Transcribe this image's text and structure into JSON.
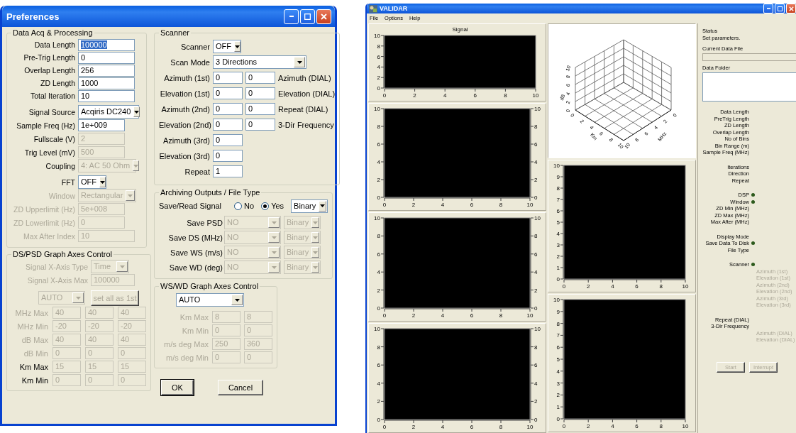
{
  "preferences": {
    "title": "Preferences",
    "acquisition": {
      "title": "Data Acq & Processing",
      "rows": [
        {
          "label": "Data Length",
          "kind": "text",
          "value": "100000",
          "disabled": false,
          "label_disabled": false,
          "highlighted": true
        },
        {
          "label": "Pre-Trig Length",
          "kind": "text",
          "value": "0",
          "disabled": false,
          "label_disabled": false,
          "highlighted": false
        },
        {
          "label": "Overlap Length",
          "kind": "text",
          "value": "256",
          "disabled": false,
          "label_disabled": false,
          "highlighted": false
        },
        {
          "label": "ZD Length",
          "kind": "text",
          "value": "1000",
          "disabled": false,
          "label_disabled": false,
          "highlighted": false
        },
        {
          "label": "Total Iteration",
          "kind": "text",
          "value": "10",
          "disabled": false,
          "label_disabled": false,
          "highlighted": false
        },
        {
          "label": "Signal Source",
          "kind": "combo",
          "value": "Acqiris DC240",
          "disabled": false,
          "label_disabled": false
        },
        {
          "label": "Sample Freq (Hz)",
          "kind": "text",
          "value": "1e+009",
          "disabled": false,
          "label_disabled": false,
          "highlighted": false
        },
        {
          "label": "Fullscale (V)",
          "kind": "text",
          "value": "2",
          "disabled": true,
          "label_disabled": false,
          "highlighted": false
        },
        {
          "label": "Trig Level (mV)",
          "kind": "text",
          "value": "500",
          "disabled": true,
          "label_disabled": false,
          "highlighted": false
        },
        {
          "label": "Coupling",
          "kind": "combo",
          "value": "4: AC 50 Ohm",
          "disabled": true,
          "label_disabled": false
        },
        {
          "label": "FFT",
          "kind": "combo",
          "value": "OFF",
          "disabled": false,
          "label_disabled": false
        },
        {
          "label": "Window",
          "kind": "combo",
          "value": "Rectangular",
          "disabled": true,
          "label_disabled": true
        },
        {
          "label": "ZD Upperlimit (Hz)",
          "kind": "text",
          "value": "5e+008",
          "disabled": true,
          "label_disabled": true,
          "highlighted": false
        },
        {
          "label": "ZD Lowerlimit (Hz)",
          "kind": "text",
          "value": "0",
          "disabled": true,
          "label_disabled": true,
          "highlighted": false
        },
        {
          "label": "Max After Index",
          "kind": "text",
          "value": "10",
          "disabled": true,
          "label_disabled": true,
          "highlighted": false
        }
      ]
    },
    "graph_axes": {
      "title": "DS/PSD Graph Axes Control",
      "rows": [
        {
          "label": "Signal X-Axis Type",
          "kind": "combo",
          "value": "Time",
          "disabled": true,
          "label_disabled": true
        },
        {
          "label": "Signal X-Axis Max",
          "kind": "text",
          "value": "100000",
          "disabled": true,
          "label_disabled": true
        }
      ],
      "mode": {
        "value": "AUTO",
        "disabled": true
      },
      "copy_button": {
        "label": "set all as 1st",
        "disabled": true
      },
      "grid": [
        {
          "label": "MHz Max",
          "values": [
            "40",
            "40",
            "40"
          ],
          "disabled": true,
          "label_disabled": true
        },
        {
          "label": "MHz Min",
          "values": [
            "-20",
            "-20",
            "-20"
          ],
          "disabled": true,
          "label_disabled": true
        },
        {
          "label": "dB Max",
          "values": [
            "40",
            "40",
            "40"
          ],
          "disabled": true,
          "label_disabled": true
        },
        {
          "label": "dB Min",
          "values": [
            "0",
            "0",
            "0"
          ],
          "disabled": true,
          "label_disabled": true
        },
        {
          "label": "Km Max",
          "values": [
            "15",
            "15",
            "15"
          ],
          "disabled": true,
          "label_disabled": false
        },
        {
          "label": "Km Min",
          "values": [
            "0",
            "0",
            "0"
          ],
          "disabled": true,
          "label_disabled": false
        }
      ]
    },
    "scanner": {
      "title": "Scanner",
      "rows": [
        {
          "label": "Scanner",
          "kind": "combo",
          "value": "OFF"
        },
        {
          "label": "Scan Mode",
          "kind": "combo",
          "value": "3 Directions"
        },
        {
          "label": "Azimuth (1st)",
          "kind": "pair",
          "values": [
            "0",
            "0"
          ],
          "note": "Azimuth (DIAL)"
        },
        {
          "label": "Elevation (1st)",
          "kind": "pair",
          "values": [
            "0",
            "0"
          ],
          "note": "Elevation (DIAL)"
        },
        {
          "label": "Azimuth (2nd)",
          "kind": "pair",
          "values": [
            "0",
            "0"
          ],
          "note": "Repeat (DIAL)"
        },
        {
          "label": "Elevation (2nd)",
          "kind": "pair",
          "values": [
            "0",
            "0"
          ],
          "note": "3-Dir Frequency"
        },
        {
          "label": "Azimuth (3rd)",
          "kind": "text",
          "value": "0"
        },
        {
          "label": "Elevation (3rd)",
          "kind": "text",
          "value": "0"
        },
        {
          "label": "Repeat",
          "kind": "text",
          "value": "1"
        }
      ]
    },
    "archiving": {
      "title": "Archiving Outputs / File Type",
      "signal": {
        "label": "Save/Read Signal",
        "options": [
          {
            "label": "No",
            "selected": false
          },
          {
            "label": "Yes",
            "selected": true
          }
        ],
        "format": "Binary"
      },
      "rows": [
        {
          "label": "Save PSD",
          "value": "NO",
          "format": "Binary",
          "disabled": true
        },
        {
          "label": "Save DS (MHz)",
          "value": "NO",
          "format": "Binary",
          "disabled": true
        },
        {
          "label": "Save WS (m/s)",
          "value": "NO",
          "format": "Binary",
          "disabled": true
        },
        {
          "label": "Save WD (deg)",
          "value": "NO",
          "format": "Binary",
          "disabled": true
        }
      ]
    },
    "ws_wd_axes": {
      "title": "WS/WD Graph Axes Control",
      "mode": "AUTO",
      "rows": [
        {
          "label": "Km Max",
          "values": [
            "8",
            "8"
          ],
          "disabled": true
        },
        {
          "label": "Km Min",
          "values": [
            "0",
            "0"
          ],
          "disabled": true
        },
        {
          "label": "m/s deg Max",
          "values": [
            "250",
            "360"
          ],
          "disabled": true
        },
        {
          "label": "m/s deg Min",
          "values": [
            "0",
            "0"
          ],
          "disabled": true
        }
      ]
    },
    "buttons": [
      {
        "label": "OK",
        "default": true
      },
      {
        "label": "Cancel",
        "default": false
      }
    ]
  },
  "validar": {
    "title": "VALIDAR",
    "menu": [
      "File",
      "Options",
      "Help"
    ],
    "plots": [
      {
        "chart_data": {
          "type": "line",
          "title": "Signal",
          "xlim": [
            0,
            10
          ],
          "ylim": [
            0,
            10
          ],
          "xticks": [
            0,
            2,
            4,
            6,
            8,
            10
          ],
          "yticks": [
            0,
            2,
            4,
            6,
            8,
            10
          ]
        }
      },
      {
        "right_yticks": [
          "10",
          "8",
          "6",
          "4",
          "2",
          "0"
        ],
        "chart_data": {
          "type": "line",
          "xlim": [
            0,
            10
          ],
          "ylim": [
            0,
            10
          ],
          "xticks": [
            0,
            2,
            4,
            6,
            8,
            10
          ],
          "yticks": [
            0,
            2,
            4,
            6,
            8,
            10
          ]
        }
      },
      {
        "right_yticks": [
          "10",
          "8",
          "6",
          "4",
          "2",
          "0"
        ],
        "chart_data": {
          "type": "line",
          "xlim": [
            0,
            10
          ],
          "ylim": [
            0,
            10
          ],
          "xticks": [
            0,
            2,
            4,
            6,
            8,
            10
          ],
          "yticks": [
            0,
            2,
            4,
            6,
            8,
            10
          ]
        }
      },
      {
        "right_yticks": [
          "10",
          "8",
          "6",
          "4",
          "2",
          "0"
        ],
        "chart_data": {
          "type": "line",
          "xlim": [
            0,
            10
          ],
          "ylim": [
            0,
            10
          ],
          "xticks": [
            0,
            2,
            4,
            6,
            8,
            10
          ],
          "yticks": [
            0,
            2,
            4,
            6,
            8,
            10
          ]
        }
      },
      {
        "chart_data": {
          "type": "line",
          "xlim": [
            0,
            10
          ],
          "ylim": [
            0,
            10
          ],
          "xticks": [
            0,
            2,
            4,
            6,
            8,
            10
          ],
          "yticks": [
            0,
            1,
            2,
            3,
            4,
            5,
            6,
            7,
            8,
            9,
            10
          ]
        }
      },
      {
        "chart_data": {
          "type": "line",
          "xlim": [
            0,
            10
          ],
          "ylim": [
            0,
            10
          ],
          "xticks": [
            0,
            2,
            4,
            6,
            8,
            10
          ],
          "yticks": [
            0,
            1,
            2,
            3,
            4,
            5,
            6,
            7,
            8,
            9,
            10
          ]
        }
      }
    ],
    "surface_plot": {
      "z_label": "dB",
      "x_label": "Km",
      "y_label": "MHz",
      "z_ticks": [
        "0",
        "2",
        "4",
        "6",
        "8",
        "10"
      ],
      "x_ticks": [
        "0",
        "2",
        "4",
        "6",
        "8",
        "10"
      ],
      "y_ticks": [
        "0",
        "2",
        "4",
        "6",
        "8",
        "10"
      ]
    },
    "status": {
      "title": "Status",
      "message": "Set parameters.",
      "current_file": {
        "label": "Current Data File",
        "disabled": true
      },
      "data_folder": {
        "label": "Data Folder"
      },
      "sections": [
        {
          "items": [
            {
              "label": "Data Length",
              "kind": "label"
            },
            {
              "label": "PreTrig Length",
              "kind": "label"
            },
            {
              "label": "ZD Length",
              "kind": "label"
            },
            {
              "label": "Overlap Length",
              "kind": "label"
            },
            {
              "label": "No of Bins",
              "kind": "label"
            },
            {
              "label": "Bin Range (m)",
              "kind": "label"
            },
            {
              "label": "Sample Freq (MHz)",
              "kind": "label"
            }
          ]
        },
        {
          "items": [
            {
              "label": "Iterations",
              "kind": "label"
            },
            {
              "label": "Direction",
              "kind": "label"
            },
            {
              "label": "Repeat",
              "kind": "label"
            }
          ]
        },
        {
          "items": [
            {
              "label": "DSP",
              "kind": "led",
              "on": false
            },
            {
              "label": "Window",
              "kind": "led",
              "on": false
            },
            {
              "label": "ZD Min (MHz)",
              "kind": "label"
            },
            {
              "label": "ZD Max (MHz)",
              "kind": "label"
            },
            {
              "label": "Max After (MHz)",
              "kind": "label"
            }
          ]
        },
        {
          "items": [
            {
              "label": "Display Mode",
              "kind": "label"
            },
            {
              "label": "Save Data To Disk",
              "kind": "led",
              "on": false
            },
            {
              "label": "File Type",
              "kind": "label"
            }
          ]
        },
        {
          "items": [
            {
              "label": "Scanner",
              "kind": "led",
              "on": false
            },
            {
              "label": "Azimuth (1st)",
              "kind": "detail"
            },
            {
              "label": "Elevation (1st)",
              "kind": "detail"
            },
            {
              "label": "Azimuth (2nd)",
              "kind": "detail"
            },
            {
              "label": "Elevation (2nd)",
              "kind": "detail"
            },
            {
              "label": "Azimuth (3rd)",
              "kind": "detail"
            },
            {
              "label": "Elevation (3rd)",
              "kind": "detail"
            }
          ]
        },
        {
          "items": [
            {
              "label": "Repeat (DIAL)",
              "kind": "label"
            },
            {
              "label": "3-Dir Frequency",
              "kind": "label"
            },
            {
              "label": "Azimuth (DIAL)",
              "kind": "detail"
            },
            {
              "label": "Elevation (DIAL)",
              "kind": "detail"
            }
          ]
        }
      ],
      "buttons": [
        {
          "label": "Start",
          "disabled": true
        },
        {
          "label": "Interrupt",
          "disabled": true
        }
      ]
    }
  }
}
